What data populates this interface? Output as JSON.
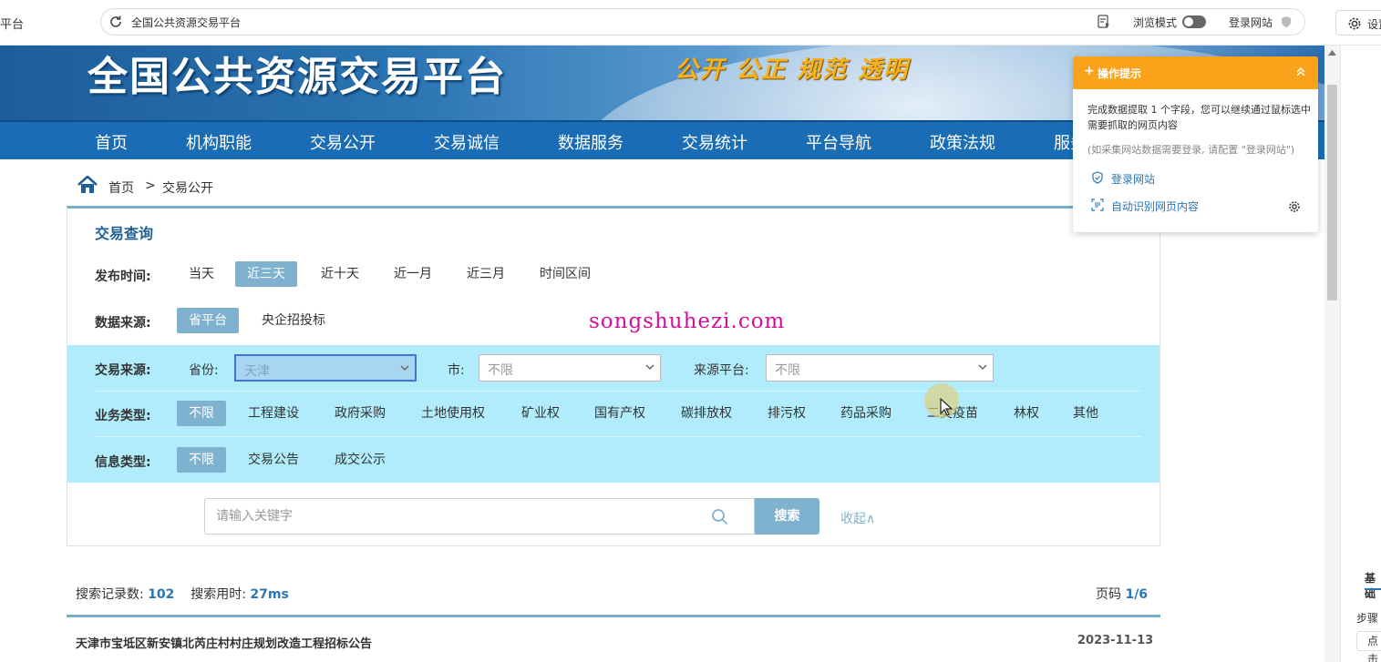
{
  "browser": {
    "tab_fragment": "平台",
    "url_text": "全国公共资源交易平台",
    "browse_mode_label": "浏览模式",
    "login_site_label": "登录网站",
    "settings_label": "设置"
  },
  "banner": {
    "title": "全国公共资源交易平台",
    "slogan": "公开 公正 规范 透明"
  },
  "nav": {
    "items": [
      "首页",
      "机构职能",
      "交易公开",
      "交易诚信",
      "数据服务",
      "交易统计",
      "平台导航",
      "政策法规",
      "服务"
    ]
  },
  "breadcrumb": {
    "home": "首页",
    "separator": ">",
    "current": "交易公开"
  },
  "query": {
    "title": "交易查询",
    "publish_time": {
      "label": "发布时间:",
      "options": [
        "当天",
        "近三天",
        "近十天",
        "近一月",
        "近三月",
        "时间区间"
      ],
      "selected": "近三天"
    },
    "data_source": {
      "label": "数据来源:",
      "options": [
        "省平台",
        "央企招投标"
      ],
      "selected": "省平台"
    },
    "trade_source": {
      "label": "交易来源:",
      "province_label": "省份:",
      "province_value": "天津",
      "city_label": "市:",
      "city_value": "不限",
      "platform_label": "来源平台:",
      "platform_value": "不限"
    },
    "business_type": {
      "label": "业务类型:",
      "options": [
        "不限",
        "工程建设",
        "政府采购",
        "土地使用权",
        "矿业权",
        "国有产权",
        "碳排放权",
        "排污权",
        "药品采购",
        "二类疫苗",
        "林权",
        "其他"
      ],
      "selected": "不限"
    },
    "info_type": {
      "label": "信息类型:",
      "options": [
        "不限",
        "交易公告",
        "成交公示"
      ],
      "selected": "不限"
    },
    "search": {
      "placeholder": "请输入关键字",
      "button": "搜索",
      "collapse": "收起∧"
    }
  },
  "watermark": "songshuhezi.com",
  "results": {
    "count_label": "搜索记录数:",
    "count": "102",
    "time_label": "搜索用时:",
    "time": "27ms",
    "page_label": "页码",
    "page": "1/6",
    "items": [
      {
        "title": "天津市宝坻区新安镇北芮庄村村庄规划改造工程招标公告",
        "date": "2023-11-13"
      }
    ]
  },
  "tip": {
    "title": "操作提示",
    "message": "完成数据提取 1 个字段，您可以继续通过鼠标选中需要抓取的网页内容",
    "hint": "(如采集网站数据需要登录, 请配置 \"登录网站\")",
    "login_link": "登录网站",
    "auto_link": "自动识别网页内容"
  },
  "right_panel": {
    "tab": "基础",
    "step": "步骤",
    "button": "点击"
  },
  "colors": {
    "nav_blue": "#1a6db5",
    "accent": "#7fb2cf",
    "band": "#b0ecfb",
    "tip_orange": "#f9a21a",
    "link_blue": "#2c75b4"
  }
}
